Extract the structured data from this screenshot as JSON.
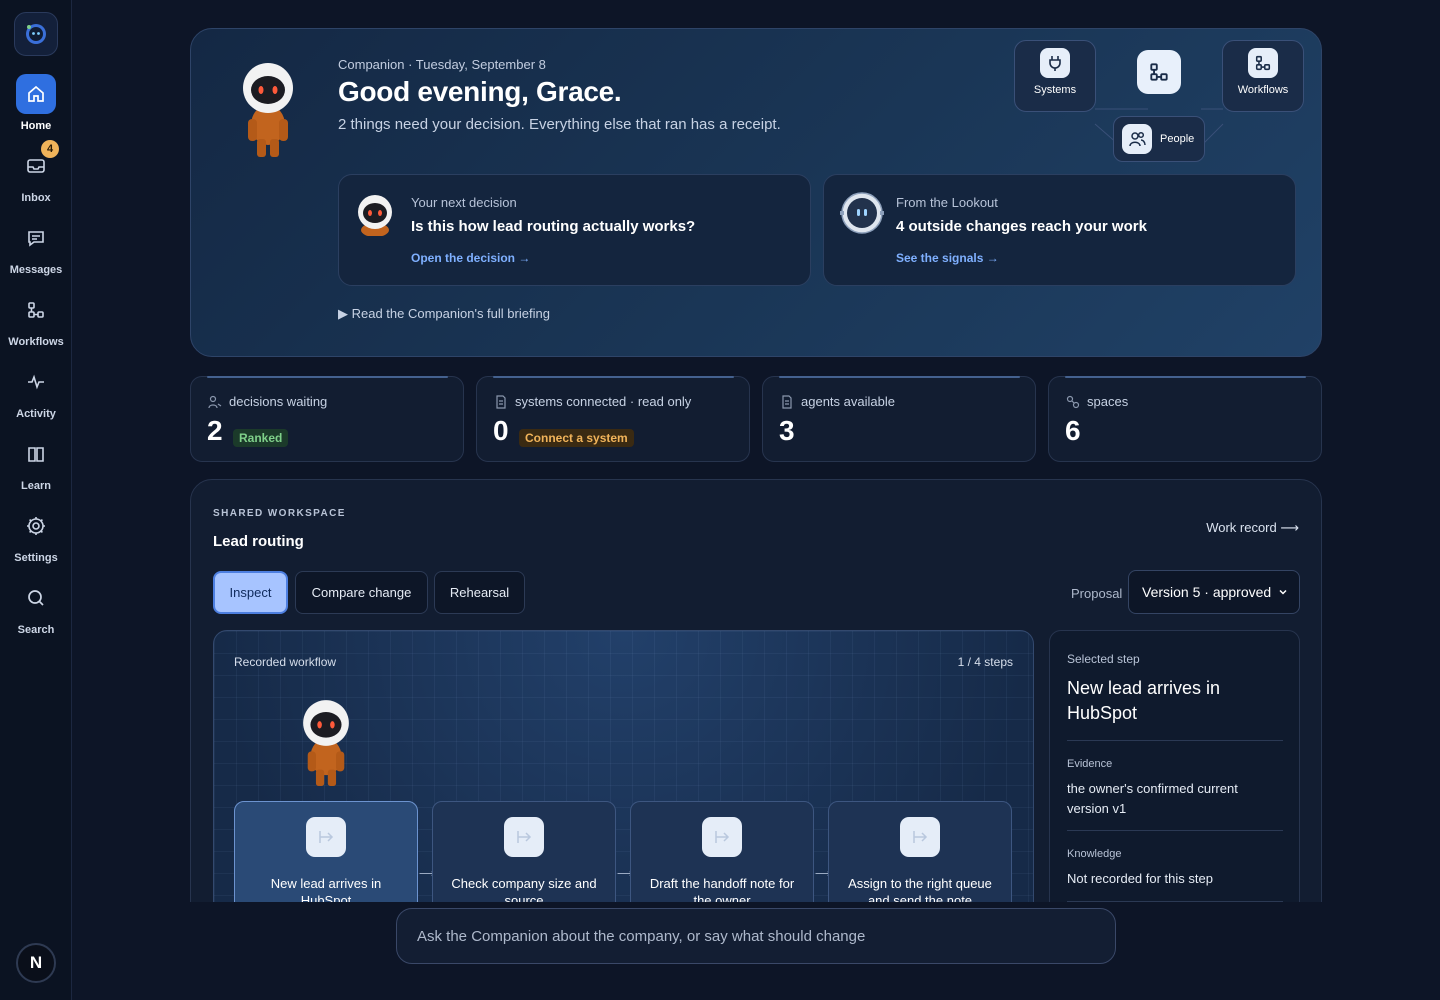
{
  "sidebar": {
    "items": [
      {
        "label": "Home",
        "icon": "home-icon",
        "active": true
      },
      {
        "label": "Inbox",
        "icon": "inbox-icon",
        "badge": "4"
      },
      {
        "label": "Messages",
        "icon": "message-icon"
      },
      {
        "label": "Workflows",
        "icon": "workflow-icon"
      },
      {
        "label": "Activity",
        "icon": "activity-icon"
      },
      {
        "label": "Learn",
        "icon": "book-icon"
      },
      {
        "label": "Settings",
        "icon": "gear-icon"
      },
      {
        "label": "Search",
        "icon": "search-icon"
      }
    ],
    "avatar": "N"
  },
  "hero": {
    "kicker": "Companion · Tuesday, September 8",
    "title": "Good evening, Grace.",
    "subtitle": "2 things need your decision. Everything else that ran has a receipt.",
    "cards": [
      {
        "kicker": "Your next decision",
        "title": "Is this how lead routing actually works?",
        "link": "Open the decision →"
      },
      {
        "kicker": "From the Lookout",
        "title": "4 outside changes reach your work",
        "link": "See the signals →"
      }
    ],
    "briefing": "▶ Read the Companion's full briefing",
    "hub": {
      "systems": "Systems",
      "workflows": "Workflows",
      "people": "People"
    }
  },
  "stats": [
    {
      "label": "decisions waiting",
      "value": "2",
      "tag": "Ranked",
      "tag_color": "#7fd08a"
    },
    {
      "label": "systems connected · read only",
      "value": "0",
      "tag": "Connect a system",
      "tag_color": "#f0b35a"
    },
    {
      "label": "agents available",
      "value": "3"
    },
    {
      "label": "spaces",
      "value": "6"
    }
  ],
  "workspace": {
    "kicker": "SHARED WORKSPACE",
    "title": "Lead routing",
    "record_link": "Work record ⟶",
    "tabs": [
      "Inspect",
      "Compare change",
      "Rehearsal"
    ],
    "proposal_label": "Proposal",
    "proposal_value": "Version 5 · approved",
    "canvas": {
      "label": "Recorded workflow",
      "steps_count": "1 / 4 steps",
      "steps": [
        "New lead arrives in HubSpot",
        "Check company size and source",
        "Draft the handoff note for the owner",
        "Assign to the right queue and send the note"
      ]
    },
    "detail": {
      "kicker": "Selected step",
      "title": "New lead arrives in HubSpot",
      "evidence_label": "Evidence",
      "evidence_value": "the owner's confirmed current version v1",
      "knowledge_label": "Knowledge",
      "knowledge_value": "Not recorded for this step"
    }
  },
  "ask": {
    "placeholder": "Ask the Companion about the company, or say what should change"
  },
  "colors": {
    "accent": "#2f6fe0",
    "link": "#7fb0ff",
    "background": "#0d1527"
  }
}
